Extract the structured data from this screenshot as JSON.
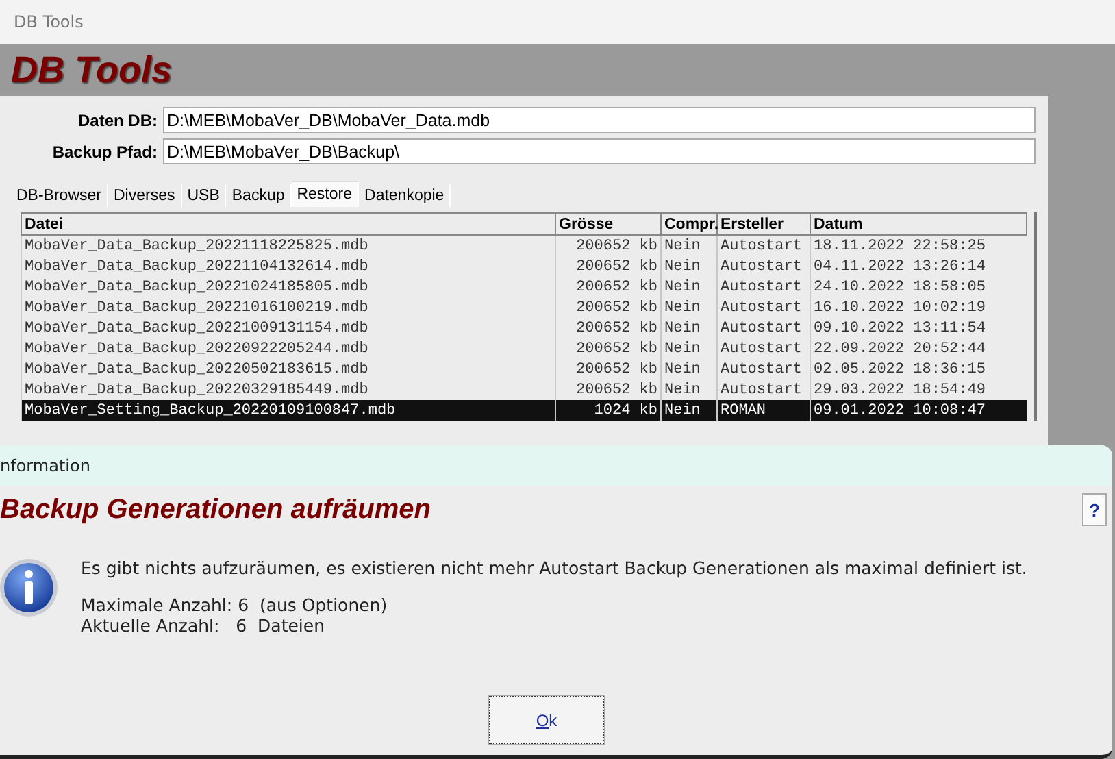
{
  "window": {
    "title": "DB Tools"
  },
  "header": {
    "title": "DB Tools"
  },
  "fields": [
    {
      "label": "Daten DB:",
      "value": "D:\\MEB\\MobaVer_DB\\MobaVer_Data.mdb"
    },
    {
      "label": "Backup Pfad:",
      "value": "D:\\MEB\\MobaVer_DB\\Backup\\"
    }
  ],
  "tabs": [
    {
      "label": "DB-Browser",
      "selected": false
    },
    {
      "label": "Diverses",
      "selected": false
    },
    {
      "label": "USB",
      "selected": false
    },
    {
      "label": "Backup",
      "selected": false
    },
    {
      "label": "Restore",
      "selected": true
    },
    {
      "label": "Datenkopie",
      "selected": false
    }
  ],
  "table": {
    "columns": [
      "Datei",
      "Grösse",
      "Compr.",
      "Ersteller",
      "Datum"
    ],
    "rows": [
      {
        "cells": [
          "MobaVer_Data_Backup_20221118225825.mdb",
          "200652 kb",
          "Nein",
          "Autostart",
          "18.11.2022 22:58:25"
        ],
        "selected": false
      },
      {
        "cells": [
          "MobaVer_Data_Backup_20221104132614.mdb",
          "200652 kb",
          "Nein",
          "Autostart",
          "04.11.2022 13:26:14"
        ],
        "selected": false
      },
      {
        "cells": [
          "MobaVer_Data_Backup_20221024185805.mdb",
          "200652 kb",
          "Nein",
          "Autostart",
          "24.10.2022 18:58:05"
        ],
        "selected": false
      },
      {
        "cells": [
          "MobaVer_Data_Backup_20221016100219.mdb",
          "200652 kb",
          "Nein",
          "Autostart",
          "16.10.2022 10:02:19"
        ],
        "selected": false
      },
      {
        "cells": [
          "MobaVer_Data_Backup_20221009131154.mdb",
          "200652 kb",
          "Nein",
          "Autostart",
          "09.10.2022 13:11:54"
        ],
        "selected": false
      },
      {
        "cells": [
          "MobaVer_Data_Backup_20220922205244.mdb",
          "200652 kb",
          "Nein",
          "Autostart",
          "22.09.2022 20:52:44"
        ],
        "selected": false
      },
      {
        "cells": [
          "MobaVer_Data_Backup_20220502183615.mdb",
          "200652 kb",
          "Nein",
          "Autostart",
          "02.05.2022 18:36:15"
        ],
        "selected": false
      },
      {
        "cells": [
          "MobaVer_Data_Backup_20220329185449.mdb",
          "200652 kb",
          "Nein",
          "Autostart",
          "29.03.2022 18:54:49"
        ],
        "selected": false
      },
      {
        "cells": [
          "MobaVer_Setting_Backup_20220109100847.mdb",
          "1024 kb",
          "Nein",
          "ROMAN",
          "09.01.2022 10:08:47"
        ],
        "selected": true
      }
    ]
  },
  "dialog": {
    "title": "nformation",
    "heading": "Backup Generationen aufräumen",
    "help": "?",
    "message": "Es gibt nichts aufzuräumen, es existieren nicht mehr Autostart Backup Generationen als maximal definiert ist.",
    "details": [
      "Maximale Anzahl: 6  (aus Optionen)",
      "Aktuelle Anzahl:   6  Dateien"
    ],
    "button": "Ok"
  }
}
